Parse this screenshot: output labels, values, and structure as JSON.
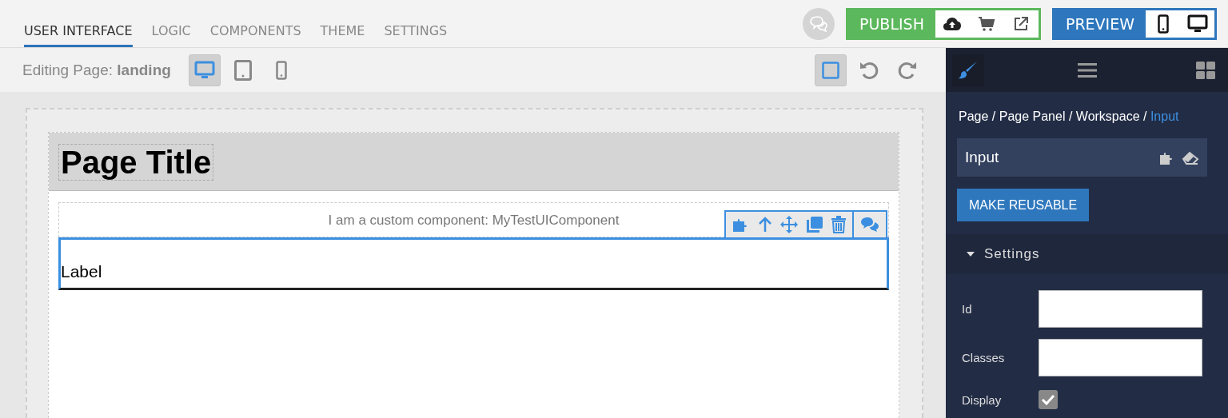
{
  "tabs": [
    {
      "label": "USER INTERFACE",
      "selected": true
    },
    {
      "label": "LOGIC",
      "selected": false
    },
    {
      "label": "COMPONENTS",
      "selected": false
    },
    {
      "label": "THEME",
      "selected": false
    },
    {
      "label": "SETTINGS",
      "selected": false
    }
  ],
  "publish": {
    "label": "PUBLISH"
  },
  "preview": {
    "label": "PREVIEW"
  },
  "toolbar": {
    "editing_label": "Editing Page:",
    "page_name": "landing",
    "devices": [
      {
        "kind": "desktop",
        "selected": true
      },
      {
        "kind": "tablet",
        "selected": false
      },
      {
        "kind": "phone",
        "selected": false
      }
    ],
    "outline_toggle": {
      "selected": true
    }
  },
  "canvas": {
    "page_title": "Page Title",
    "custom_component_text": "I am a custom component: MyTestUIComponent",
    "input_label": "Label"
  },
  "panel": {
    "tabs": [
      {
        "kind": "brush",
        "selected": true
      },
      {
        "kind": "list",
        "selected": false
      },
      {
        "kind": "grid",
        "selected": false
      }
    ],
    "breadcrumb_separator": "/",
    "breadcrumb": [
      {
        "label": "Page",
        "current": false
      },
      {
        "label": "Page Panel",
        "current": false
      },
      {
        "label": "Workspace",
        "current": false
      },
      {
        "label": "Input",
        "current": true
      }
    ],
    "component_name": "Input",
    "make_reusable": "MAKE REUSABLE",
    "section": {
      "title": "Settings",
      "expanded": true
    },
    "fields": [
      {
        "kind": "text",
        "label": "Id"
      },
      {
        "kind": "text",
        "label": "Classes"
      },
      {
        "kind": "checkbox",
        "label": "Display",
        "checked": true
      }
    ]
  }
}
